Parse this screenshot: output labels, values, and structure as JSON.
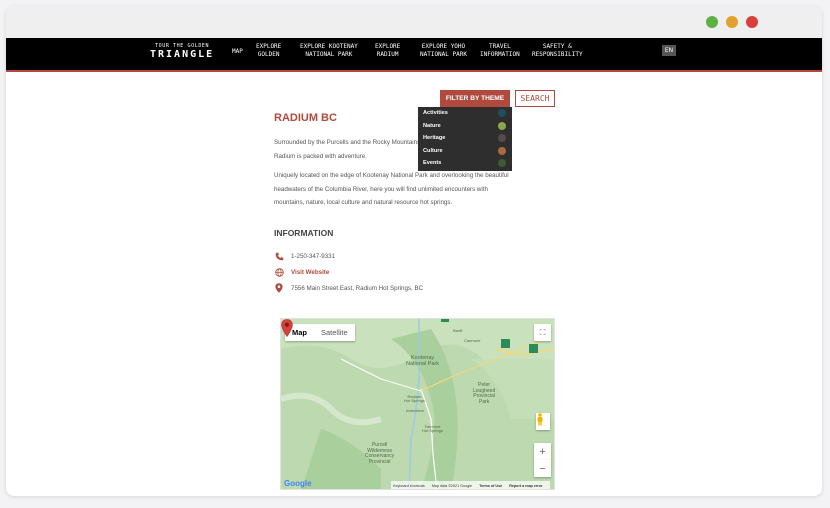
{
  "window": {
    "controls": [
      "green",
      "orange",
      "red"
    ]
  },
  "nav": {
    "brand_top": "TOUR THE GOLDEN",
    "brand_bottom": "TRIANGLE",
    "items": [
      {
        "label": "MAP"
      },
      {
        "label": "EXPLORE\nGOLDEN"
      },
      {
        "label": "EXPLORE KOOTENAY\nNATIONAL PARK"
      },
      {
        "label": "EXPLORE\nRADIUM"
      },
      {
        "label": "EXPLORE YOHO\nNATIONAL PARK"
      },
      {
        "label": "TRAVEL\nINFORMATION"
      },
      {
        "label": "SAFETY &\nRESPONSIBILITY"
      }
    ],
    "lang": "EN"
  },
  "filter": {
    "button_label": "FILTER BY THEME",
    "search_label": "SEARCH",
    "options": [
      {
        "label": "Activities",
        "color": "#1f4e5f"
      },
      {
        "label": "Nature",
        "color": "#8ea54a"
      },
      {
        "label": "Heritage",
        "color": "#5a4a4a"
      },
      {
        "label": "Culture",
        "color": "#a86a3e"
      },
      {
        "label": "Events",
        "color": "#3d5a36"
      }
    ]
  },
  "article": {
    "title": "RADIUM BC",
    "paragraph1": "Surrounded by the Purcells and the Rocky Mountains, Radium is packed with adventure.",
    "paragraph2": "Uniquely located on the edge of Kootenay National Park and overlooking the beautiful headwaters of the Columbia River, here you will find unlimited encounters with mountains, nature, local culture and natural resource hot springs."
  },
  "info": {
    "heading": "INFORMATION",
    "phone": "1-250-347-9331",
    "website": "Visit Website",
    "address": "7556 Main Street East, Radium Hot Springs, BC"
  },
  "map": {
    "tab_map": "Map",
    "tab_satellite": "Satellite",
    "labels": {
      "park1": "Kootenay\nNational Park",
      "park2": "Peter\nLougheed\nProvincial\nPark",
      "park3": "Purcell\nWilderness\nConservancy\nProvincial",
      "town1": "Canmore",
      "town2": "Invermere",
      "town3": "Fairmont\nHot Springs",
      "town4": "Radium\nHot Springs",
      "town5": "Banff"
    },
    "footer": [
      "Keyboard shortcuts",
      "Map data ©2021 Google",
      "Terms of Use",
      "Report a map error"
    ],
    "logo": "Google",
    "accent": "#d8403c"
  }
}
